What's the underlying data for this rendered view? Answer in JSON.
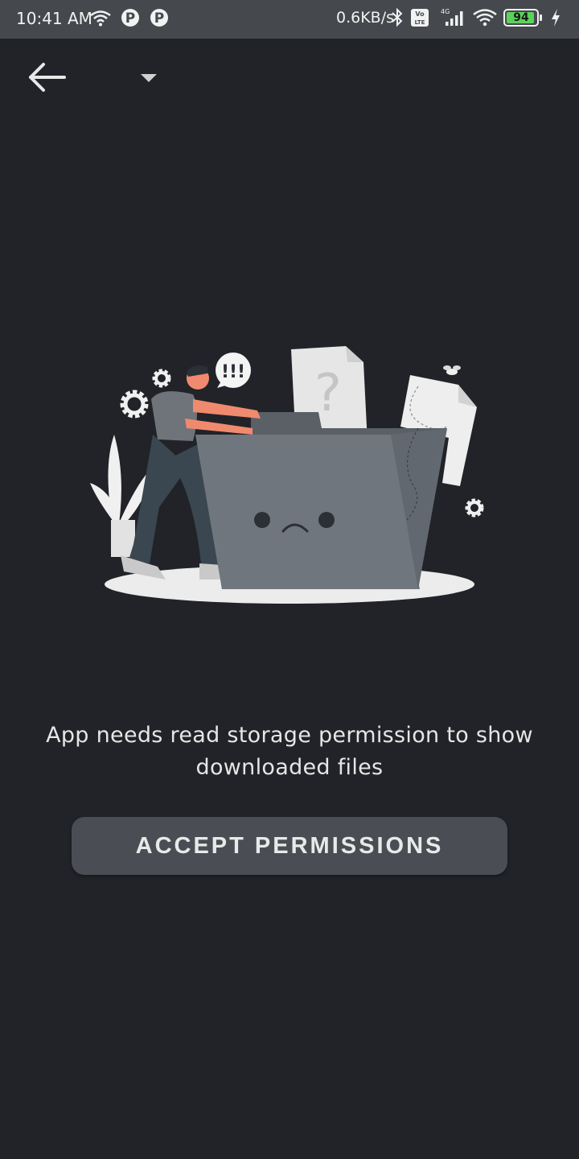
{
  "status_bar": {
    "time": "10:41 AM",
    "network_speed": "0.6KB/s",
    "battery_level": "94",
    "icons": [
      "wifi-icon",
      "parking-app-icon",
      "parking-app-icon",
      "bluetooth-icon",
      "volte-icon",
      "signal-4g-icon",
      "wifi-icon",
      "battery-icon",
      "charging-icon"
    ]
  },
  "toolbar": {
    "back_icon": "arrow-left-icon",
    "dropdown_icon": "caret-down-icon"
  },
  "illustration": {
    "speech_bubble": "!!!",
    "document_mark": "?"
  },
  "message": "App needs read storage permission to show downloaded files",
  "accept_button": {
    "label": "ACCEPT PERMISSIONS"
  },
  "colors": {
    "background": "#212328",
    "status_bar": "#45494e",
    "button": "#4a4e54",
    "battery_fill": "#5cd15c"
  }
}
